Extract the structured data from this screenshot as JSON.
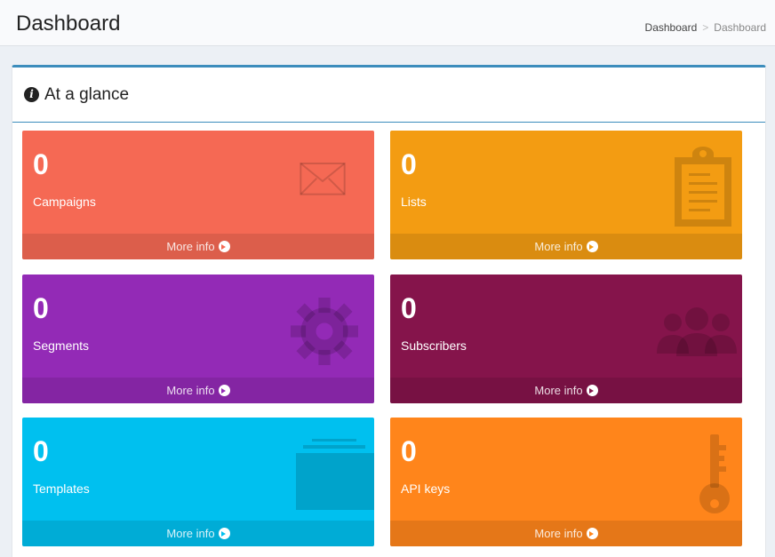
{
  "header": {
    "title": "Dashboard",
    "breadcrumb": [
      "Dashboard",
      "Dashboard"
    ],
    "separator": ">"
  },
  "box": {
    "title": "At a glance",
    "icon": "info-circle-icon"
  },
  "tiles": [
    {
      "count": "0",
      "label": "Campaigns",
      "link": "More info",
      "color": "#f56954",
      "icon": "envelope-icon"
    },
    {
      "count": "0",
      "label": "Lists",
      "link": "More info",
      "color": "#f39c12",
      "icon": "clipboard-icon"
    },
    {
      "count": "0",
      "label": "Segments",
      "link": "More info",
      "color": "#932ab6",
      "icon": "gear-icon"
    },
    {
      "count": "0",
      "label": "Subscribers",
      "link": "More info",
      "color": "#85144b",
      "icon": "users-icon"
    },
    {
      "count": "0",
      "label": "Templates",
      "link": "More info",
      "color": "#00c0ef",
      "icon": "folder-stack-icon"
    },
    {
      "count": "0",
      "label": "API keys",
      "link": "More info",
      "color": "#ff851b",
      "icon": "key-icon"
    }
  ]
}
